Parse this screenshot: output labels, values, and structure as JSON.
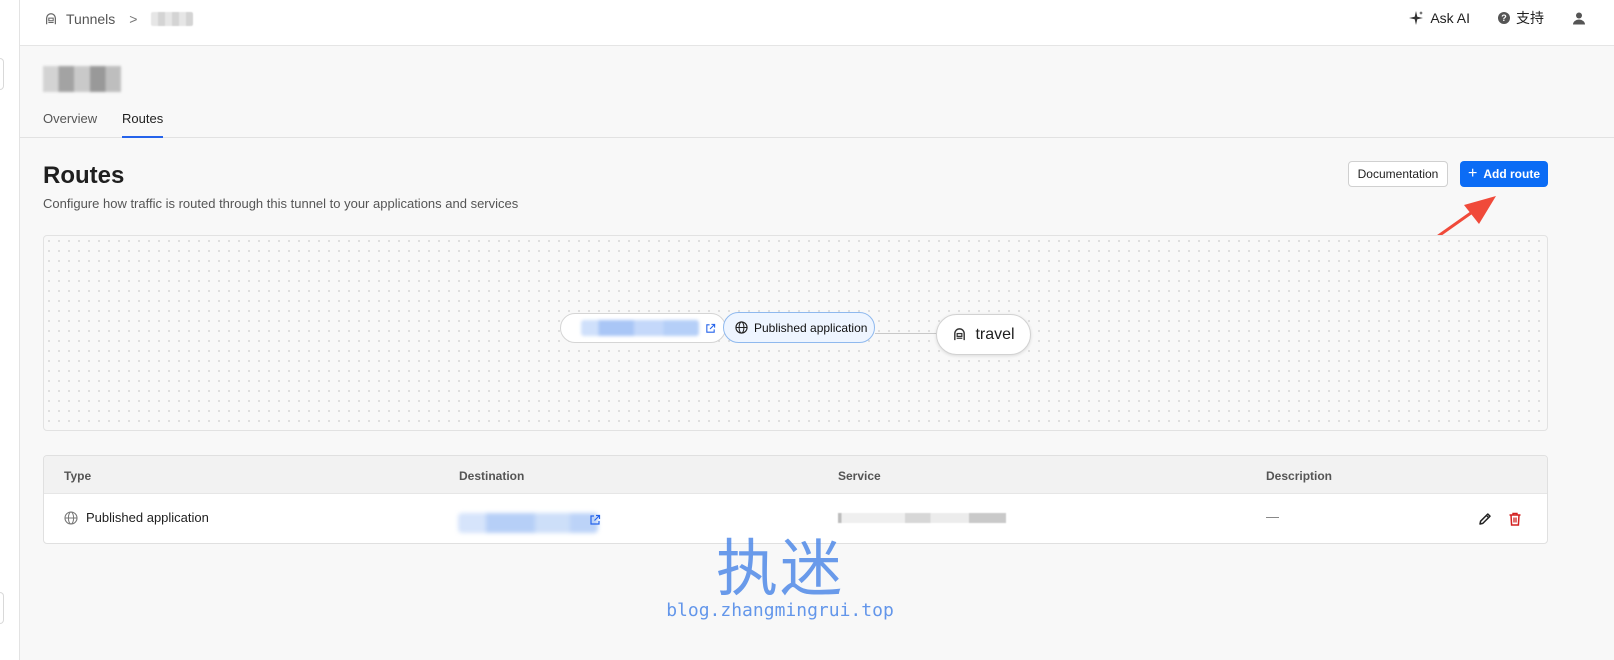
{
  "breadcrumb": {
    "root": "Tunnels",
    "separator": ">"
  },
  "top_actions": {
    "ask_ai": "Ask AI",
    "support": "支持"
  },
  "tabs": [
    {
      "label": "Overview",
      "active": false
    },
    {
      "label": "Routes",
      "active": true
    }
  ],
  "section": {
    "title": "Routes",
    "subtitle": "Configure how traffic is routed through this tunnel to your applications and services",
    "documentation_label": "Documentation",
    "add_route_label": "Add route",
    "plus_symbol": "+"
  },
  "diagram": {
    "app_node_label": "Published application",
    "tunnel_node_label": "travel"
  },
  "table": {
    "headers": [
      "Type",
      "Destination",
      "Service",
      "Description"
    ],
    "rows": [
      {
        "type": "Published application",
        "description": "—"
      }
    ]
  },
  "watermark": {
    "chinese": "执迷",
    "url": "blog.zhangmingrui.top"
  },
  "colors": {
    "accent": "#0b6cf5",
    "delete": "#d32020",
    "annotation_arrow": "#f04a3a",
    "watermark": "#4a86e8"
  }
}
